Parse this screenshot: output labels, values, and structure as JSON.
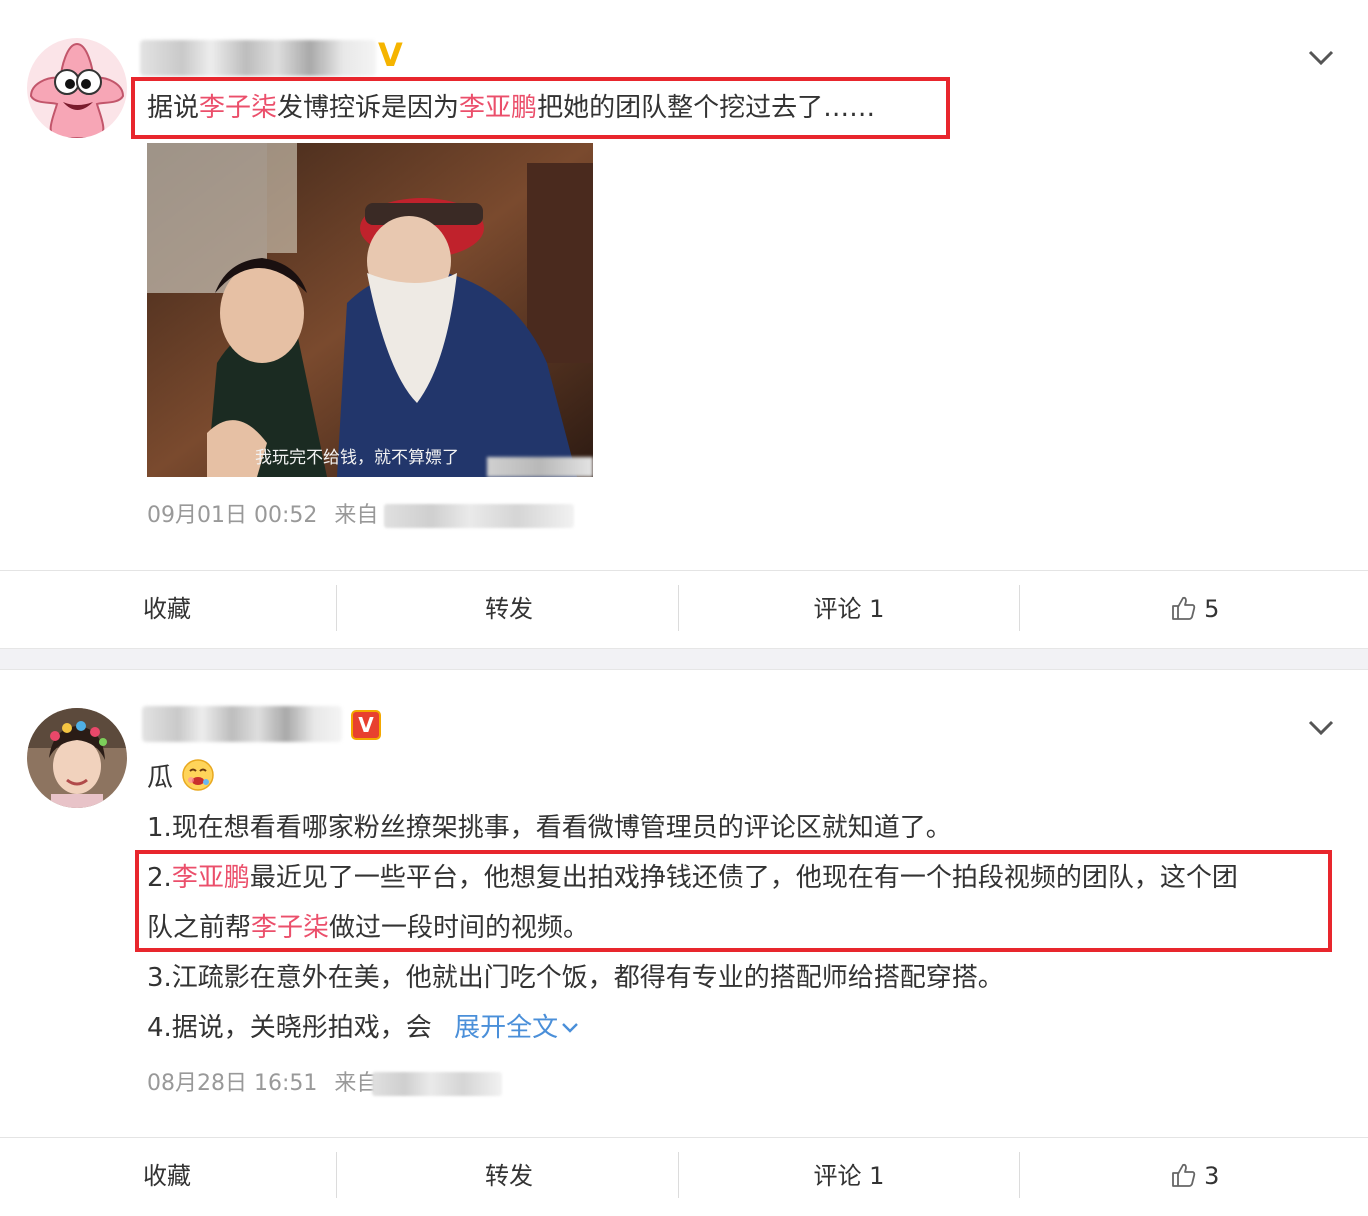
{
  "posts": [
    {
      "author_avatar": "patrick-star-avatar",
      "badge": "V",
      "text_parts": [
        "据说",
        "李子柒",
        "发博控诉是因为",
        "李亚鹏",
        "把她的团队整个挖过去了……"
      ],
      "image": {
        "subtitle": "我玩完不给钱，就不算嫖了"
      },
      "time": "09月01日 00:52",
      "from_label": "来自",
      "actions": {
        "favorite": "收藏",
        "repost": "转发",
        "comment": "评论 1",
        "like_count": "5"
      }
    },
    {
      "author_avatar": "woman-flower-crown-avatar",
      "badge": "V",
      "line0": "瓜",
      "line1": "1.现在想看看哪家粉丝撩架挑事，看看微博管理员的评论区就知道了。",
      "line2_parts": [
        "2.",
        "李亚鹏",
        "最近见了一些平台，他想复出拍戏挣钱还债了，他现在有一个拍段视频的团队，这个团"
      ],
      "line3_parts": [
        "队之前帮",
        "李子柒",
        "做过一段时间的视频。"
      ],
      "line4": "3.江疏影在意外在美，他就出门吃个饭，都得有专业的搭配师给搭配穿搭。",
      "line5": "4.据说，关晓彤拍戏，会",
      "expand_label": "展开全文",
      "time": "08月28日 16:51",
      "from_label": "来自",
      "actions": {
        "favorite": "收藏",
        "repost": "转发",
        "comment": "评论 1",
        "like_count": "3"
      }
    }
  ],
  "colors": {
    "highlight": "#eb4f6b",
    "link": "#4a8fd9",
    "redbox": "#e8262d",
    "meta": "#999999"
  }
}
